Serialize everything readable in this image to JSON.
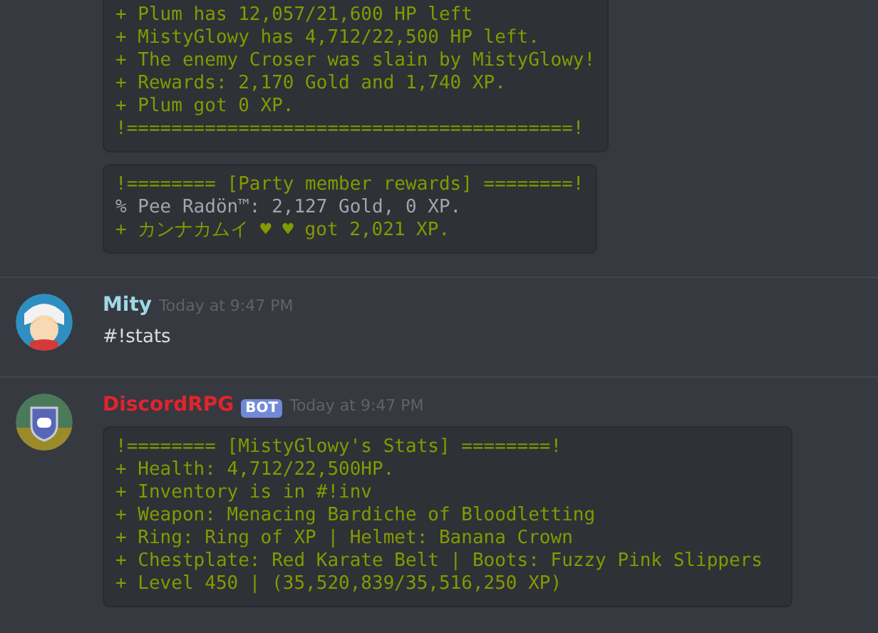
{
  "messages": [
    {
      "code_blocks": [
        {
          "lines": [
            {
              "kind": "plus",
              "text": "+ Plum has 12,057/21,600 HP left"
            },
            {
              "kind": "plus",
              "text": "+ MistyGlowy has 4,712/22,500 HP left."
            },
            {
              "kind": "plus",
              "text": "+ The enemy Croser was slain by MistyGlowy!"
            },
            {
              "kind": "plus",
              "text": "+ Rewards: 2,170 Gold and 1,740 XP."
            },
            {
              "kind": "plus",
              "text": "+ Plum got 0 XP."
            },
            {
              "kind": "header",
              "text": "!========================================!"
            }
          ]
        },
        {
          "lines": [
            {
              "kind": "header",
              "text": "!======== [Party member rewards] ========!"
            },
            {
              "kind": "percent",
              "text": "% Pee Radön™: 2,127 Gold, 0 XP."
            },
            {
              "kind": "plus",
              "text": "+ カンナカムイ ♥ ♥ got 2,021 XP."
            }
          ]
        }
      ]
    },
    {
      "author": {
        "name": "Mity",
        "color": "#9fd8e6",
        "bot": false
      },
      "time": "Today at 9:47 PM",
      "text": "#!stats"
    },
    {
      "author": {
        "name": "DiscordRPG",
        "color": "#e0242e",
        "bot": true,
        "bot_label": "BOT"
      },
      "time": "Today at 9:47 PM",
      "code_blocks": [
        {
          "lines": [
            {
              "kind": "header",
              "text": "!======== [MistyGlowy's Stats] ========!"
            },
            {
              "kind": "plus",
              "text": "+ Health: 4,712/22,500HP."
            },
            {
              "kind": "plus",
              "text": "+ Inventory is in #!inv"
            },
            {
              "kind": "plus",
              "text": "+ Weapon: Menacing Bardiche of Bloodletting"
            },
            {
              "kind": "plus",
              "text": "+ Ring: Ring of XP | Helmet: Banana Crown"
            },
            {
              "kind": "plus",
              "text": "+ Chestplate: Red Karate Belt | Boots: Fuzzy Pink Slippers"
            },
            {
              "kind": "plus",
              "text": "+ Level 450 | (35,520,839/35,516,250 XP)"
            }
          ]
        }
      ]
    }
  ]
}
